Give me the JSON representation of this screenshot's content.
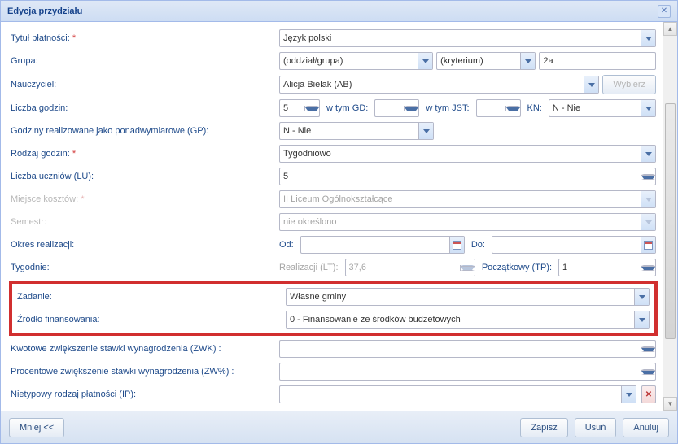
{
  "window": {
    "title": "Edycja przydziału"
  },
  "labels": {
    "tytul": "Tytuł płatności:",
    "grupa": "Grupa:",
    "nauczyciel": "Nauczyciel:",
    "liczbaGodzin": "Liczba godzin:",
    "wTymGD": "w tym GD:",
    "wTymJST": "w tym JST:",
    "kn": "KN:",
    "gp": "Godziny realizowane jako ponadwymiarowe (GP):",
    "rodzajGodzin": "Rodzaj godzin:",
    "liczbaUczniow": "Liczba uczniów (LU):",
    "miejsceKosztow": "Miejsce kosztów:",
    "semestr": "Semestr:",
    "okres": "Okres realizacji:",
    "od": "Od:",
    "do": "Do:",
    "tygodnie": "Tygodnie:",
    "realizacjiLT": "Realizacji (LT):",
    "poczatkowyTP": "Początkowy (TP):",
    "zadanie": "Zadanie:",
    "zrodlo": "Źródło finansowania:",
    "zwk": "Kwotowe zwiększenie stawki wynagrodzenia (ZWK) :",
    "zwproc": "Procentowe zwiększenie stawki wynagrodzenia (ZW%) :",
    "ip": "Nietypowy rodzaj płatności (IP):"
  },
  "values": {
    "tytul": "Język polski",
    "grupaOddzial": "(oddział/grupa)",
    "grupaKryt": "(kryterium)",
    "grupaVal": "2a",
    "nauczyciel": "Alicja Bielak (AB)",
    "liczbaGodzin": "5",
    "kn": "N - Nie",
    "gp": "N - Nie",
    "rodzajGodzin": "Tygodniowo",
    "liczbaUczniow": "5",
    "miejsceKosztow": "II Liceum Ogólnokształcące",
    "semestr": "nie określono",
    "realizacjiLT": "37,6",
    "poczatkowyTP": "1",
    "zadanie": "Własne gminy",
    "zrodlo": "0 - Finansowanie ze środków budżetowych"
  },
  "buttons": {
    "wybierz": "Wybierz",
    "mniej": "Mniej <<",
    "zapisz": "Zapisz",
    "usun": "Usuń",
    "anuluj": "Anuluj"
  }
}
